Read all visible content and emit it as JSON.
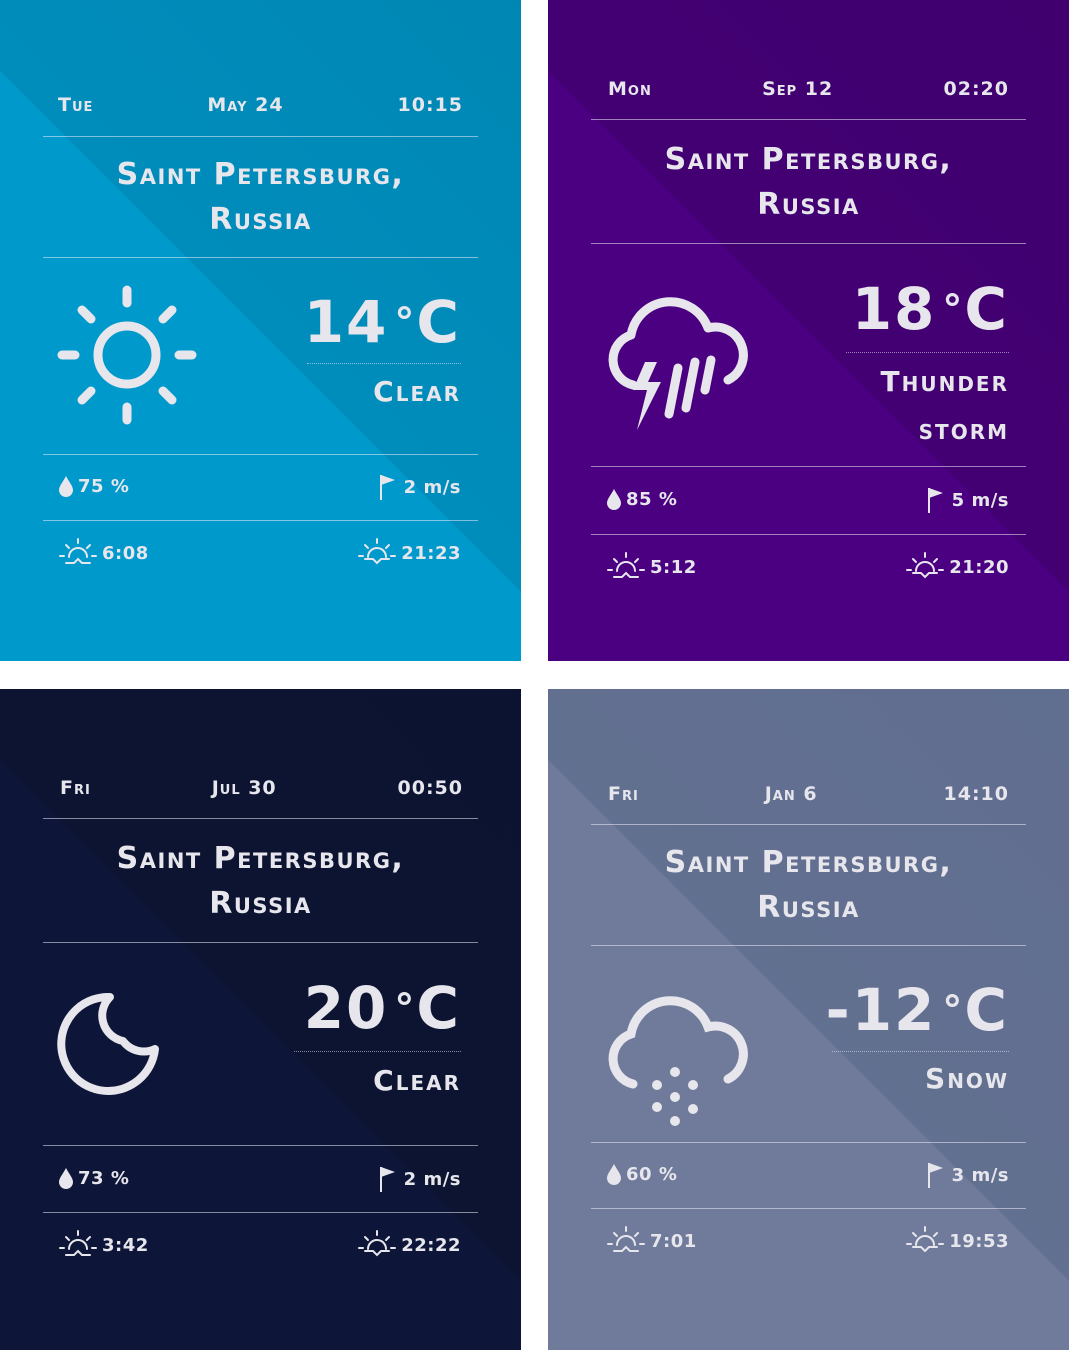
{
  "cards": [
    {
      "day": "Tue",
      "date": "May 24",
      "time": "10:15",
      "city_line1": "Saint Petersburg,",
      "city_line2": "Russia",
      "temp": "14",
      "deg": "°",
      "unit": "C",
      "condition_line1": "Clear",
      "condition_line2": "",
      "humidity": "75 %",
      "wind": "2 m/s",
      "sunrise": "6:08",
      "sunset": "21:23",
      "icon": "sun-icon",
      "color": "#0096cc"
    },
    {
      "day": "Mon",
      "date": "Sep 12",
      "time": "02:20",
      "city_line1": "Saint Petersburg,",
      "city_line2": "Russia",
      "temp": "18",
      "deg": "°",
      "unit": "C",
      "condition_line1": "Thunder",
      "condition_line2": "storm",
      "humidity": "85 %",
      "wind": "5 m/s",
      "sunrise": "5:12",
      "sunset": "21:20",
      "icon": "thunderstorm-icon",
      "color": "#4a0080"
    },
    {
      "day": "Fri",
      "date": "Jul 30",
      "time": "00:50",
      "city_line1": "Saint Petersburg,",
      "city_line2": "Russia",
      "temp": "20",
      "deg": "°",
      "unit": "C",
      "condition_line1": "Clear",
      "condition_line2": "",
      "humidity": "73 %",
      "wind": "2 m/s",
      "sunrise": "3:42",
      "sunset": "22:22",
      "icon": "moon-icon",
      "color": "#0c1434"
    },
    {
      "day": "Fri",
      "date": "Jan 6",
      "time": "14:10",
      "city_line1": "Saint Petersburg,",
      "city_line2": "Russia",
      "temp": "-12",
      "deg": "°",
      "unit": "C",
      "condition_line1": "Snow",
      "condition_line2": "",
      "humidity": "60 %",
      "wind": "3 m/s",
      "sunrise": "7:01",
      "sunset": "19:53",
      "icon": "snow-cloud-icon",
      "color": "#6e7a9a"
    }
  ]
}
